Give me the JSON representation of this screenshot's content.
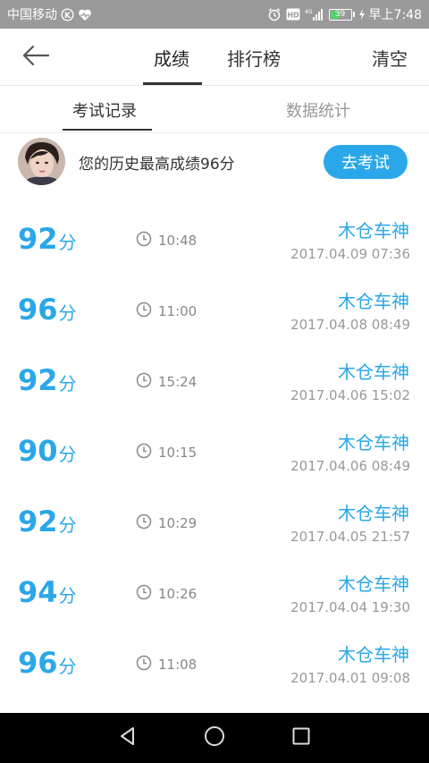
{
  "status_bar": {
    "carrier": "中国移动",
    "battery_level": "39",
    "time": "早上7:48",
    "network": "4G"
  },
  "header": {
    "tab_score": "成绩",
    "tab_rank": "排行榜",
    "clear_label": "清空"
  },
  "subtabs": {
    "records": "考试记录",
    "stats": "数据统计"
  },
  "profile": {
    "best_score_text": "您的历史最高成绩96分",
    "exam_button": "去考试"
  },
  "score_unit": "分",
  "records": [
    {
      "score": "92",
      "duration": "10:48",
      "name": "木仓车神",
      "datetime": "2017.04.09  07:36"
    },
    {
      "score": "96",
      "duration": "11:00",
      "name": "木仓车神",
      "datetime": "2017.04.08  08:49"
    },
    {
      "score": "92",
      "duration": "15:24",
      "name": "木仓车神",
      "datetime": "2017.04.06  15:02"
    },
    {
      "score": "90",
      "duration": "10:15",
      "name": "木仓车神",
      "datetime": "2017.04.06  08:49"
    },
    {
      "score": "92",
      "duration": "10:29",
      "name": "木仓车神",
      "datetime": "2017.04.05  21:57"
    },
    {
      "score": "94",
      "duration": "10:26",
      "name": "木仓车神",
      "datetime": "2017.04.04  19:30"
    },
    {
      "score": "96",
      "duration": "11:08",
      "name": "木仓车神",
      "datetime": "2017.04.01  09:08"
    }
  ],
  "colors": {
    "accent": "#2aa7e8",
    "status_bar": "#9a9a9a",
    "nav_bar": "#000000"
  }
}
